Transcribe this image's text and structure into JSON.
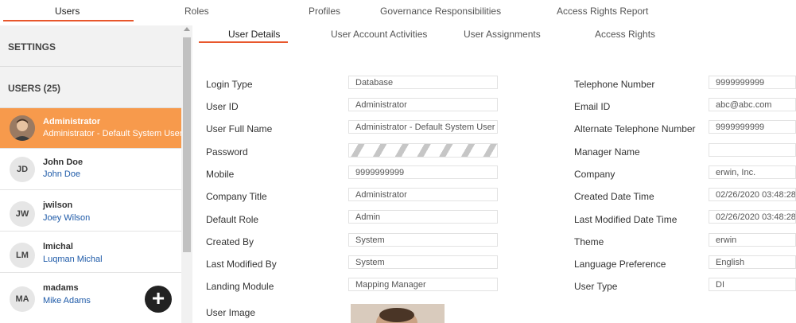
{
  "top_tabs": [
    "Users",
    "Roles",
    "Profiles",
    "Governance Responsibilities",
    "Access Rights Report"
  ],
  "sidebar": {
    "settings_label": "SETTINGS",
    "users_header": "USERS (25)",
    "users": [
      {
        "username": "Administrator",
        "full_name": "Administrator - Default System User",
        "initials": ""
      },
      {
        "username": "John Doe",
        "full_name": "John Doe",
        "initials": "JD"
      },
      {
        "username": "jwilson",
        "full_name": "Joey Wilson",
        "initials": "JW"
      },
      {
        "username": "lmichal",
        "full_name": "Luqman Michal",
        "initials": "LM"
      },
      {
        "username": "madams",
        "full_name": "Mike Adams",
        "initials": "MA"
      }
    ],
    "add_button": "+"
  },
  "sub_tabs": [
    "User Details",
    "User Account Activities",
    "User Assignments",
    "Access Rights"
  ],
  "details_left": [
    {
      "label": "Login Type",
      "value": "Database"
    },
    {
      "label": "User ID",
      "value": "Administrator"
    },
    {
      "label": "User Full Name",
      "value": "Administrator - Default System User"
    },
    {
      "label": "Password",
      "value": ""
    },
    {
      "label": "Mobile",
      "value": "9999999999"
    },
    {
      "label": "Company Title",
      "value": "Administrator"
    },
    {
      "label": "Default Role",
      "value": "Admin"
    },
    {
      "label": "Created By",
      "value": "System"
    },
    {
      "label": "Last Modified By",
      "value": "System"
    },
    {
      "label": "Landing Module",
      "value": "Mapping Manager"
    },
    {
      "label": "User Image",
      "value": ""
    }
  ],
  "details_right": [
    {
      "label": "Telephone Number",
      "value": "9999999999"
    },
    {
      "label": "Email ID",
      "value": "abc@abc.com"
    },
    {
      "label": "Alternate Telephone Number",
      "value": "9999999999"
    },
    {
      "label": "Manager Name",
      "value": ""
    },
    {
      "label": "Company",
      "value": "erwin, Inc."
    },
    {
      "label": "Created Date Time",
      "value": "02/26/2020 03:48:28"
    },
    {
      "label": "Last Modified Date Time",
      "value": "02/26/2020 03:48:28"
    },
    {
      "label": "Theme",
      "value": "erwin"
    },
    {
      "label": "Language Preference",
      "value": "English"
    },
    {
      "label": "User Type",
      "value": "DI"
    }
  ],
  "colors": {
    "accent": "#e8572c",
    "selected_row": "#f79a4c",
    "link": "#1e5aa8"
  }
}
